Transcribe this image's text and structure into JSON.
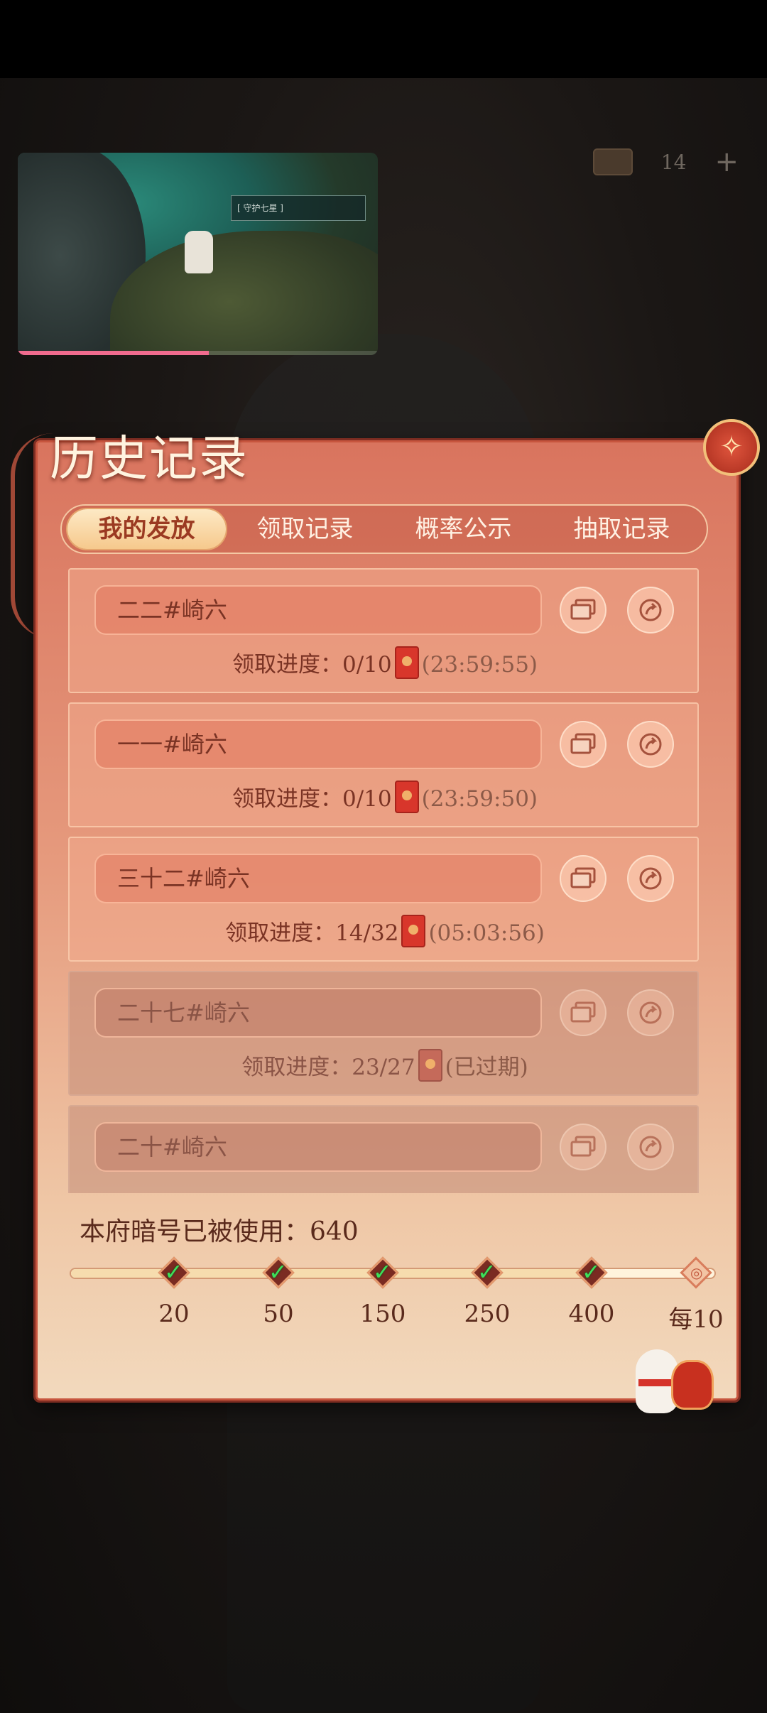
{
  "top_hud": {
    "count": "14",
    "plus": "+"
  },
  "video": {
    "tag": "[ 守护七星 ]",
    "progress": 0.53
  },
  "panel": {
    "title": "历史记录"
  },
  "tabs": [
    {
      "label": "我的发放",
      "active": true
    },
    {
      "label": "领取记录",
      "active": false
    },
    {
      "label": "概率公示",
      "active": false
    },
    {
      "label": "抽取记录",
      "active": false
    }
  ],
  "records": [
    {
      "name": "二二#崎六",
      "progress_label": "领取进度：",
      "progress": "0/10",
      "time": "(23:59:55)",
      "expired": false
    },
    {
      "name": "一一#崎六",
      "progress_label": "领取进度：",
      "progress": "0/10",
      "time": "(23:59:50)",
      "expired": false
    },
    {
      "name": "三十二#崎六",
      "progress_label": "领取进度：",
      "progress": "14/32",
      "time": "(05:03:56)",
      "expired": false
    },
    {
      "name": "二十七#崎六",
      "progress_label": "领取进度：",
      "progress": "23/27",
      "time": "(已过期)",
      "expired": true
    },
    {
      "name": "二十#崎六",
      "progress_label": "",
      "progress": "",
      "time": "",
      "expired": true
    }
  ],
  "usage": {
    "text": "本府暗号已被使用：640"
  },
  "milestones": [
    {
      "label": "20",
      "done": true
    },
    {
      "label": "50",
      "done": true
    },
    {
      "label": "150",
      "done": true
    },
    {
      "label": "250",
      "done": true
    },
    {
      "label": "400",
      "done": true
    },
    {
      "label": "每10",
      "done": false
    }
  ],
  "colors": {
    "accent": "#c7553e",
    "check": "#3de05a",
    "tab_active_text": "#9b3a22"
  }
}
